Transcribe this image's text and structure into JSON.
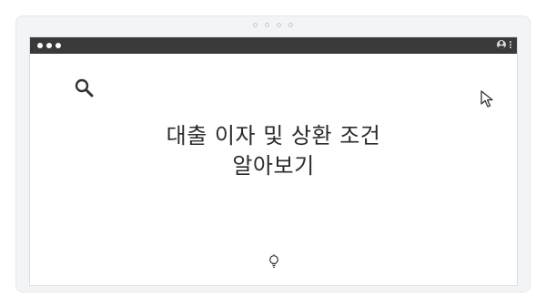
{
  "browser": {
    "window_controls": [
      "close",
      "minimize",
      "maximize"
    ],
    "icons": {
      "profile": "user-icon",
      "menu": "kebab-menu-icon"
    }
  },
  "content": {
    "headline_line1": "대출 이자 및 상환 조건",
    "headline_line2": "알아보기",
    "icons": {
      "search": "search-icon",
      "cursor": "cursor-icon",
      "idea": "lightbulb-icon"
    }
  },
  "colors": {
    "titlebar": "#3a3a3a",
    "frame_background": "#f3f4f6",
    "text": "#2b2b2b"
  }
}
